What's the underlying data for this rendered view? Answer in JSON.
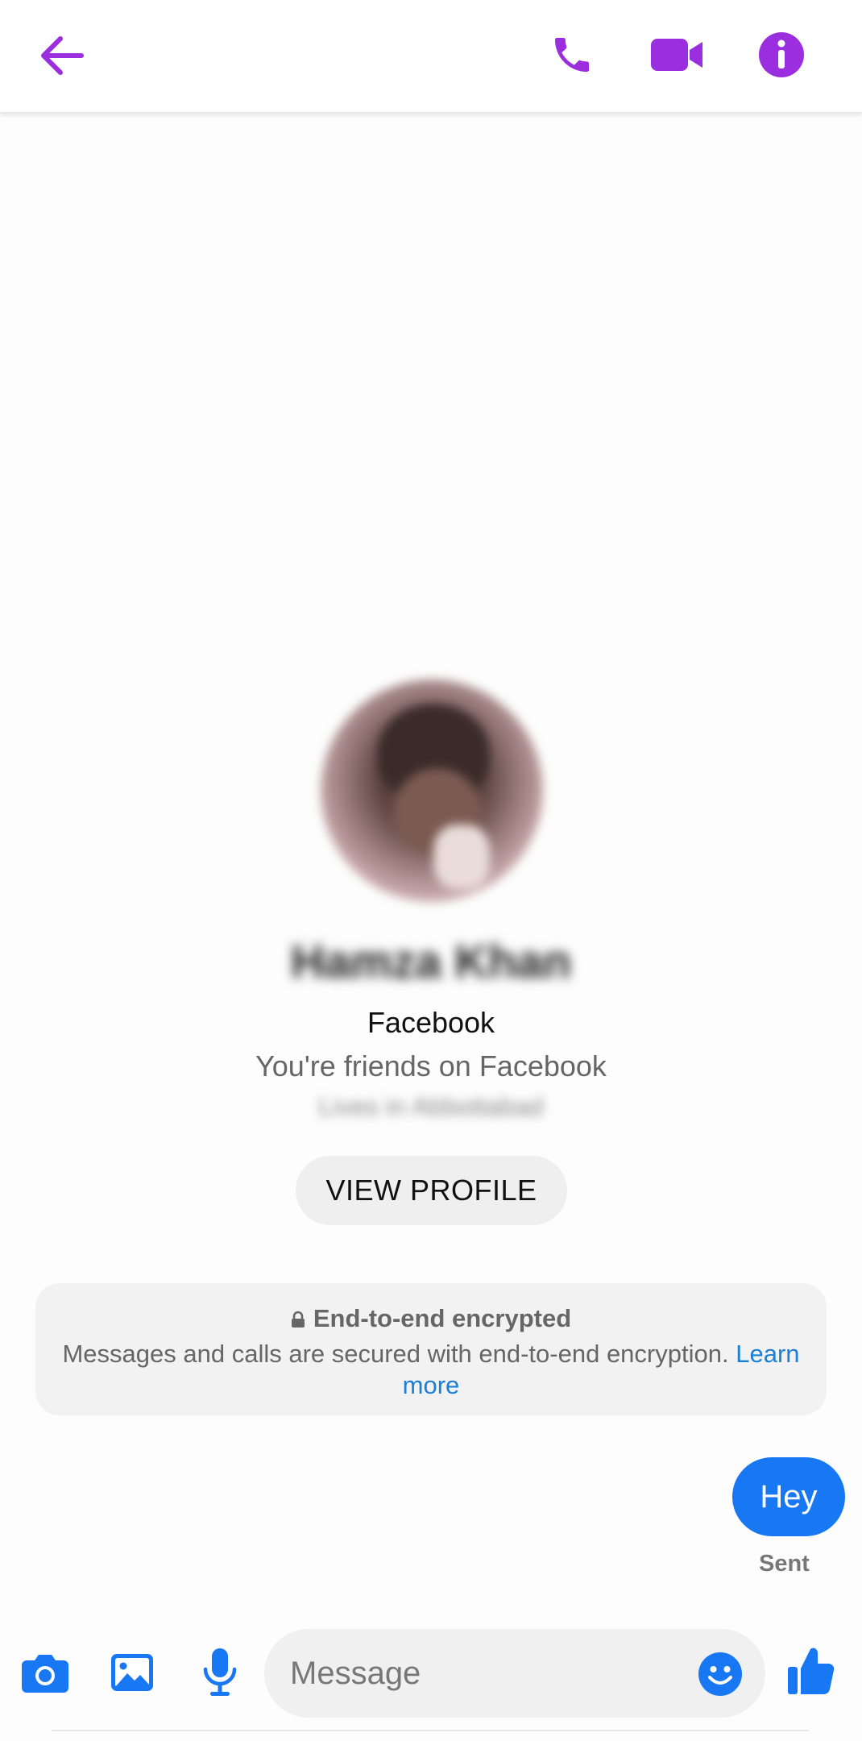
{
  "header": {
    "icons": {
      "back": "back-arrow-icon",
      "call": "phone-icon",
      "video": "video-camera-icon",
      "info": "info-icon"
    },
    "accent_color": "#9b2fe0"
  },
  "profile": {
    "name": "Hamza Khan",
    "platform": "Facebook",
    "friendship": "You're friends on Facebook",
    "location": "Lives in Abbottabad",
    "view_profile_label": "VIEW PROFILE"
  },
  "encryption": {
    "title": "End-to-end encrypted",
    "body": "Messages and calls are secured with end-to-end encryption.",
    "link": "Learn more"
  },
  "conversation": {
    "messages": [
      {
        "text": "Hey",
        "status": "Sent"
      }
    ],
    "bubble_color": "#1877f2"
  },
  "composer": {
    "placeholder": "Message",
    "icons": [
      "camera-icon",
      "gallery-icon",
      "microphone-icon",
      "emoji-icon",
      "thumbs-up-icon"
    ],
    "icon_color": "#1877f2"
  }
}
